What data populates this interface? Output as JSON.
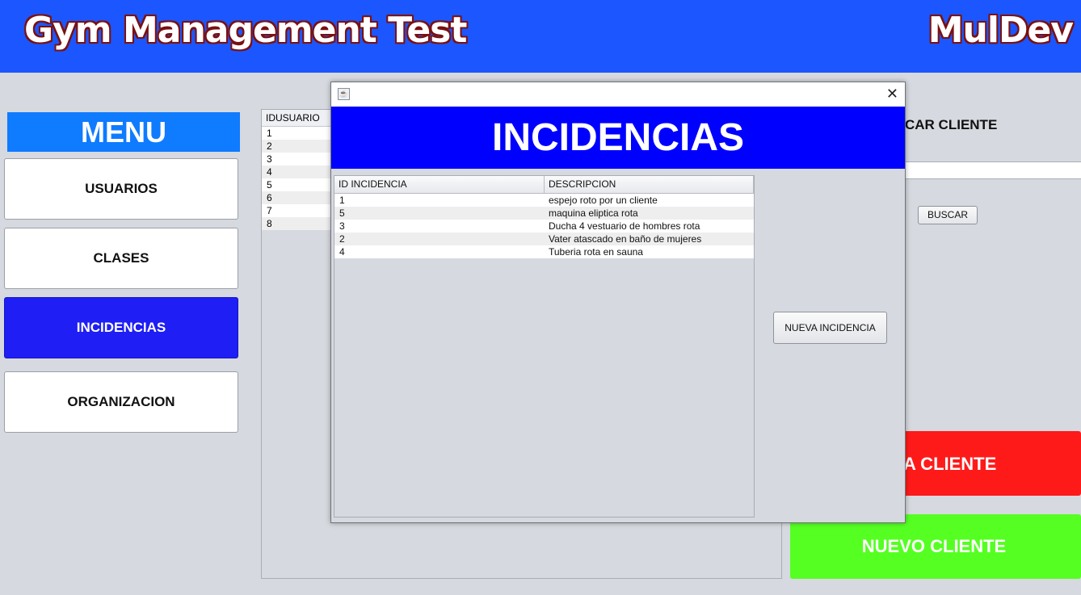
{
  "header": {
    "title": "Gym Management  Test",
    "brand": "MulDev"
  },
  "menu": {
    "title": "MENU",
    "items": [
      {
        "label": "USUARIOS"
      },
      {
        "label": "CLASES"
      },
      {
        "label": "INCIDENCIAS"
      },
      {
        "label": "ORGANIZACION"
      }
    ]
  },
  "background_table": {
    "header": "IDUSUARIO",
    "rows": [
      "1",
      "2",
      "3",
      "4",
      "5",
      "6",
      "7",
      "8"
    ]
  },
  "right_panel": {
    "search_label": "CAR CLIENTE",
    "search_button": "BUSCAR",
    "delete_button": "A CLIENTE",
    "new_button": "NUEVO CLIENTE"
  },
  "dialog": {
    "title": "INCIDENCIAS",
    "table": {
      "columns": [
        "ID INCIDENCIA",
        "DESCRIPCION"
      ],
      "rows": [
        [
          "1",
          "espejo roto por un cliente"
        ],
        [
          "5",
          "maquina eliptica rota"
        ],
        [
          "3",
          "Ducha 4 vestuario de hombres rota"
        ],
        [
          "2",
          "Vater atascado en baño de mujeres"
        ],
        [
          "4",
          "Tuberia rota en sauna"
        ]
      ]
    },
    "new_button": "NUEVA INCIDENCIA"
  },
  "colors": {
    "header_bg": "#1c56ff",
    "menu_title_bg": "#0f7bff",
    "active_menu_bg": "#1e1ef5",
    "dialog_header_bg": "#0000ff",
    "delete_bg": "#ff1a1a",
    "new_bg": "#55ff22"
  }
}
